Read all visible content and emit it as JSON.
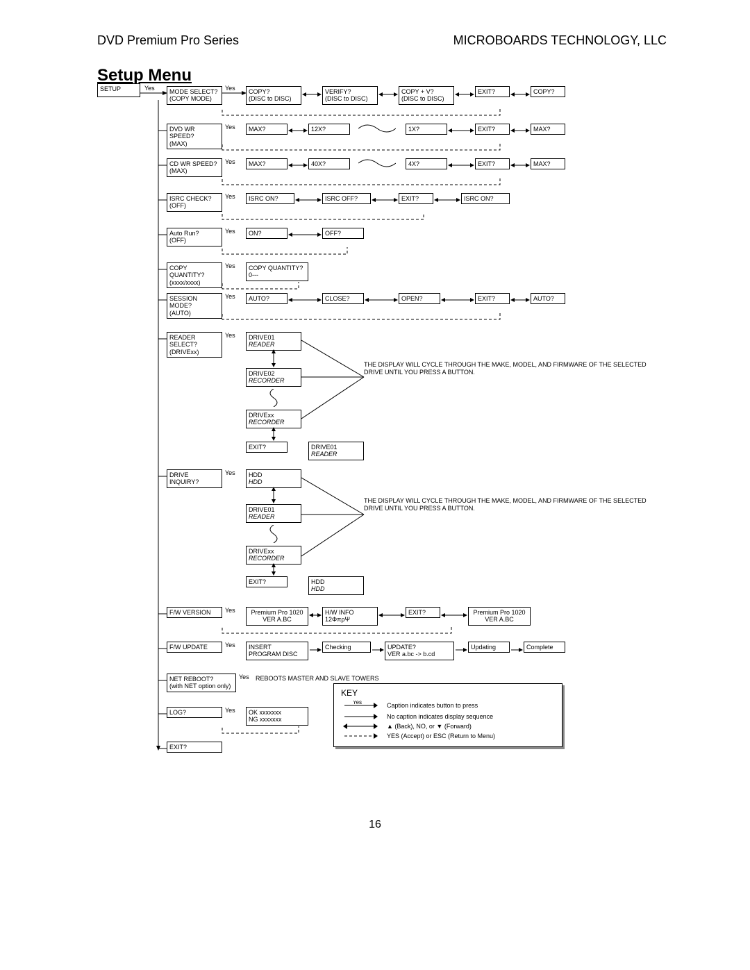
{
  "header": {
    "left": "DVD Premium Pro Series",
    "right": "MICROBOARDS TECHNOLOGY, LLC"
  },
  "title": "Setup Menu",
  "page_number": "16",
  "yes_label": "Yes",
  "key": {
    "title": "KEY",
    "row1": "Caption indicates button to press",
    "row2": "No caption indicates display sequence",
    "row3": "▲ (Back),  NO, or ▼ (Forward)",
    "row4": "YES (Accept) or ESC (Return to Menu)"
  },
  "notes": {
    "reader_cycle": "THE DISPLAY WILL CYCLE\nTHROUGH THE MAKE, MODEL,\nAND FIRMWARE OF THE\nSELECTED DRIVE UNTIL YOU\nPRESS A BUTTON.",
    "inquiry_cycle": "THE DISPLAY WILL CYCLE\nTHROUGH THE MAKE, MODEL,\nAND FIRMWARE OF THE\nSELECTED DRIVE UNTIL YOU\nPRESS A BUTTON."
  },
  "rows": {
    "r1": {
      "setup": "SETUP",
      "mode_select": "MODE SELECT?\n(COPY MODE)",
      "copy": "COPY?\n(DISC to DISC)",
      "verify": "VERIFY?\n(DISC to DISC)",
      "copyv": "COPY + V?\n(DISC to DISC)",
      "exit": "EXIT?",
      "wrap": "COPY?"
    },
    "r2": {
      "main": "DVD WR\nSPEED?\n(MAX)",
      "a": "MAX?",
      "b": "12X?",
      "c": "1X?",
      "exit": "EXIT?",
      "wrap": "MAX?"
    },
    "r3": {
      "main": "CD WR SPEED?\n(MAX)",
      "a": "MAX?",
      "b": "40X?",
      "c": "4X?",
      "exit": "EXIT?",
      "wrap": "MAX?"
    },
    "r4": {
      "main": "ISRC CHECK?\n(OFF)",
      "a": "ISRC ON?",
      "b": "ISRC OFF?",
      "exit": "EXIT?",
      "wrap": "ISRC ON?"
    },
    "r5": {
      "main": "Auto Run?\n(OFF)",
      "a": "ON?",
      "b": "OFF?"
    },
    "r6": {
      "main": "COPY QUANTITY?\n(xxxx/xxxx)",
      "a": "COPY QUANTITY?\n0---"
    },
    "r7": {
      "main": "SESSION MODE?\n(AUTO)",
      "a": "AUTO?",
      "b": "CLOSE?",
      "c": "OPEN?",
      "exit": "EXIT?",
      "wrap": "AUTO?"
    },
    "r8": {
      "main": "READER SELECT?\n(DRIVExx)",
      "d1_t": "DRIVE01",
      "d1_s": "READER",
      "d2_t": "DRIVE02",
      "d2_s": "RECORDER",
      "dx_t": "DRIVExx",
      "dx_s": "RECORDER",
      "exit": "EXIT?",
      "wrap_t": "DRIVE01",
      "wrap_s": "READER"
    },
    "r9": {
      "main": "DRIVE INQUIRY?",
      "h_t": "HDD",
      "h_s": "HDD",
      "d1_t": "DRIVE01",
      "d1_s": "READER",
      "dx_t": "DRIVExx",
      "dx_s": "RECORDER",
      "exit": "EXIT?",
      "wrap_t": "HDD",
      "wrap_s": "HDD"
    },
    "r10": {
      "main": "F/W VERSION",
      "a": "Premium Pro 1020\nVER A.BC",
      "b": "H/W INFO\n12ΦπρΨ",
      "exit": "EXIT?",
      "wrap": "Premium Pro 1020\nVER A.BC"
    },
    "r11": {
      "main": "F/W UPDATE",
      "a": "INSERT\nPROGRAM DISC",
      "b": "Checking",
      "c": "UPDATE?\nVER a.bc -> b.cd",
      "d": "Updating",
      "e": "Complete"
    },
    "r12": {
      "main": "NET REBOOT?\n(with NET option only)",
      "a": "REBOOTS MASTER\nAND SLAVE TOWERS"
    },
    "r13": {
      "main": "LOG?",
      "a": "OK   xxxxxxx\nNG   xxxxxxx"
    },
    "r14": {
      "main": "EXIT?"
    }
  }
}
